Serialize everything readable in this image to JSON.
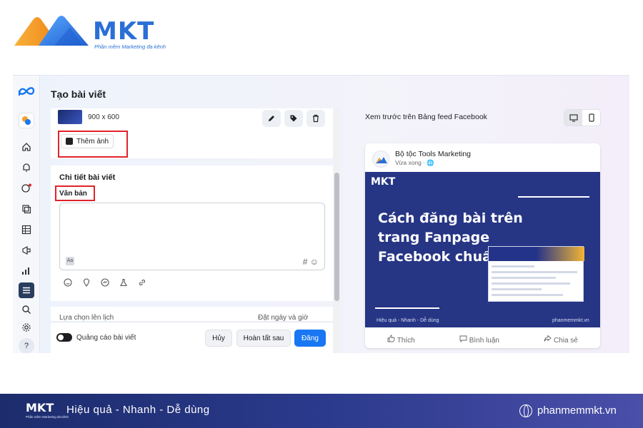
{
  "brand": {
    "name": "MKT",
    "tagline": "Phần mềm Marketing đa kênh"
  },
  "app": {
    "title": "Tạo bài viết"
  },
  "sidebar": {
    "icons": [
      "meta-icon",
      "page-icon",
      "home-icon",
      "bell-icon",
      "chat-icon",
      "stack-icon",
      "table-icon",
      "megaphone-icon",
      "chart-icon",
      "menu-icon",
      "search-icon",
      "gear-icon",
      "help-icon"
    ]
  },
  "media": {
    "dimensions": "900 x 600",
    "add_photo_label": "Thêm ảnh"
  },
  "details": {
    "title": "Chi tiết bài viết",
    "text_label": "Văn bản",
    "text_value": "",
    "text_left_badge": "Aa",
    "hashtag_symbol": "#",
    "emoji_symbol": "☺"
  },
  "schedule": {
    "label": "Lựa chọn lên lịch",
    "right_label": "Đặt ngày và giờ"
  },
  "footer": {
    "ads_label": "Quảng cáo bài viết",
    "cancel_label": "Hủy",
    "later_label": "Hoàn tất sau",
    "post_label": "Đăng"
  },
  "preview": {
    "title": "Xem trước trên Bảng feed Facebook",
    "page_name": "Bộ tộc Tools Marketing",
    "time": "Vừa xong · 🌐",
    "image_logo": "MKT",
    "headline": "Cách đăng bài trên trang Fanpage Facebook chuẩn",
    "image_footer_left": "Hiệu quả - Nhanh - Dễ dùng",
    "image_footer_right": "phanmemmkt.vn",
    "like_label": "Thích",
    "comment_label": "Bình luận",
    "share_label": "Chia sẻ"
  },
  "banner": {
    "logo": "MKT",
    "logo_sub": "Phần mềm Marketing đa kênh",
    "slogan": "Hiệu quả - Nhanh - Dễ dùng",
    "url": "phanmemmkt.vn"
  },
  "colors": {
    "brand_blue": "#2a6fd6",
    "brand_orange": "#f3a02e",
    "fb_blue": "#1877f2",
    "highlight_red": "#e0242b",
    "banner_navy": "#1c2c6c"
  }
}
